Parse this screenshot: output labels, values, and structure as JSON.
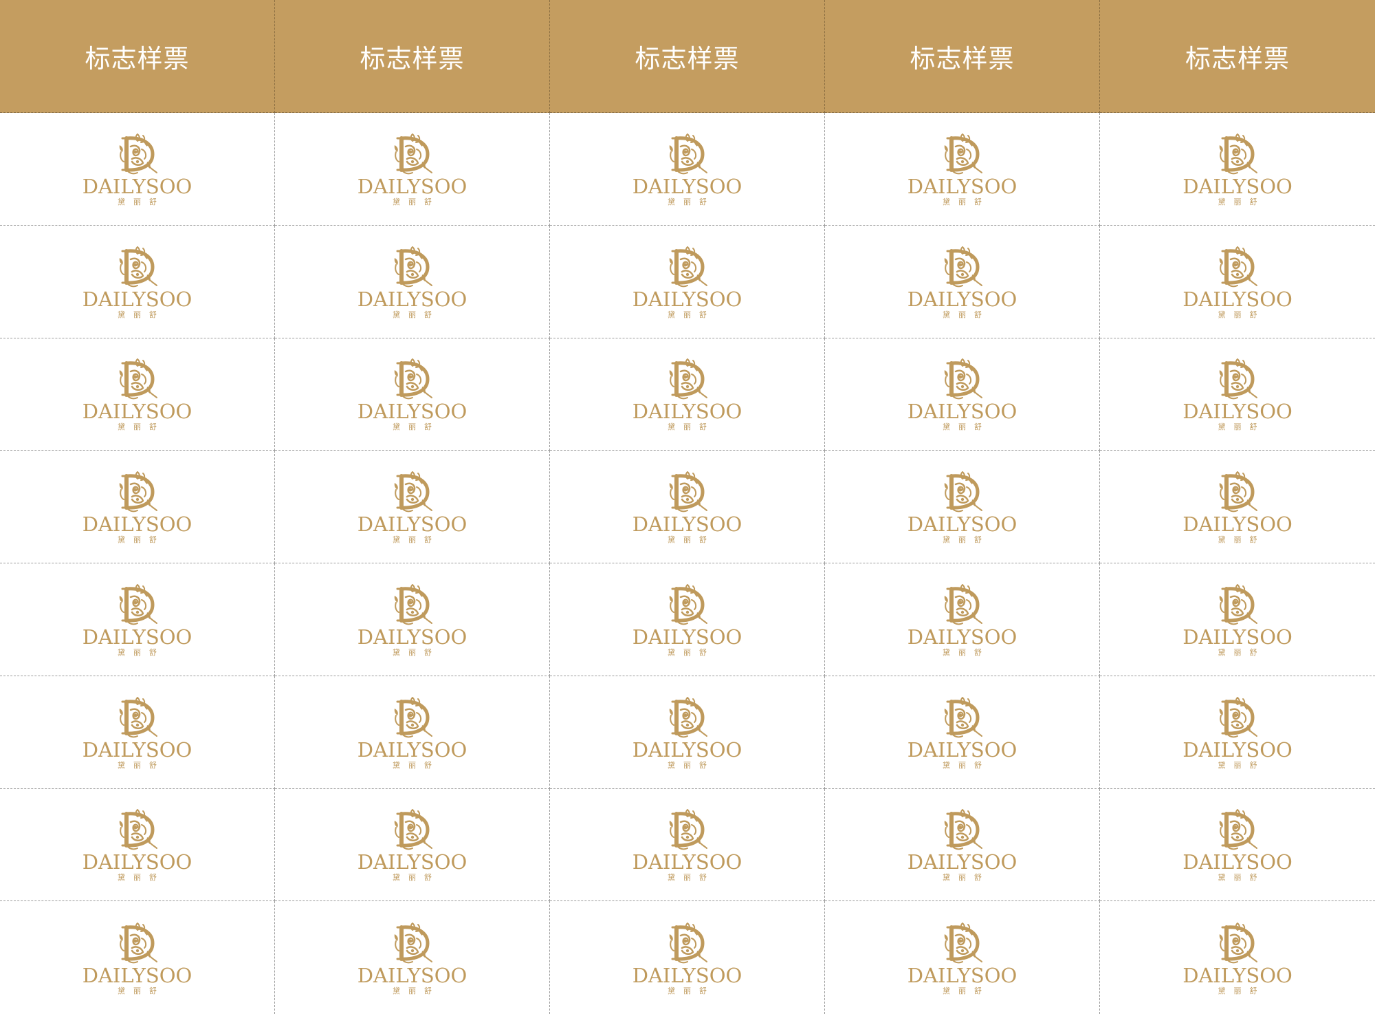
{
  "header": {
    "columns": [
      "标志样票",
      "标志样票",
      "标志样票",
      "标志样票",
      "标志样票"
    ]
  },
  "logo": {
    "wordmark": "DAILYSOO",
    "subtitle": "黛丽舒",
    "emblem_icon": "ornate-letter-d-icon",
    "color": "#bf9a5c"
  },
  "grid": {
    "rows": 8,
    "cols": 5
  },
  "colors": {
    "header_background": "#c49d60",
    "header_text": "#ffffff",
    "cell_background": "#ffffff",
    "divider": "#9a9a9a"
  }
}
